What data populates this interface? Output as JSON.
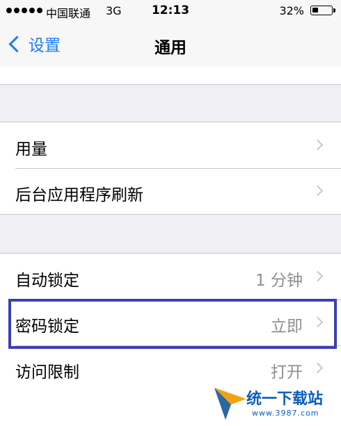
{
  "status_bar": {
    "carrier": "中国联通",
    "network": "3G",
    "time": "12:13",
    "battery": "32%",
    "battery_level": 0.32
  },
  "nav": {
    "back_label": "设置",
    "title": "通用"
  },
  "groups": [
    {
      "rows": [
        {
          "label": "用量",
          "value": ""
        },
        {
          "label": "后台应用程序刷新",
          "value": ""
        }
      ]
    },
    {
      "rows": [
        {
          "label": "自动锁定",
          "value": "1 分钟"
        },
        {
          "label": "密码锁定",
          "value": "立即"
        },
        {
          "label": "访问限制",
          "value": "打开"
        }
      ]
    }
  ],
  "watermark": {
    "text": "统一下载站",
    "url": "www.3987.com"
  },
  "colors": {
    "accent": "#1a7cf5",
    "highlight_box": "#3c3fb4",
    "background": "#efeff4"
  }
}
